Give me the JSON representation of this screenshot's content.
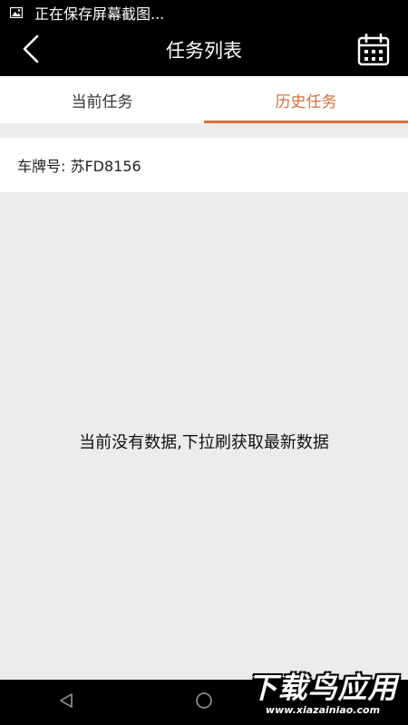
{
  "status_bar": {
    "image_icon": "image-icon",
    "text": "正在保存屏幕截图..."
  },
  "header": {
    "back_icon": "back-arrow-icon",
    "title": "任务列表",
    "calendar_icon": "calendar-icon"
  },
  "tabs": [
    {
      "label": "当前任务",
      "active": false
    },
    {
      "label": "历史任务",
      "active": true
    }
  ],
  "plate": {
    "text": "车牌号: 苏FD8156"
  },
  "empty_message": "当前没有数据,下拉刷获取最新数据",
  "nav_bar": {
    "back_icon": "triangle-back-icon",
    "home_icon": "circle-home-icon"
  },
  "watermark": {
    "main": "下载鸟应用",
    "url": "www.xiazainiao.com"
  },
  "colors": {
    "accent": "#d9703e",
    "bar_background": "#000000",
    "page_background": "#ececec"
  }
}
